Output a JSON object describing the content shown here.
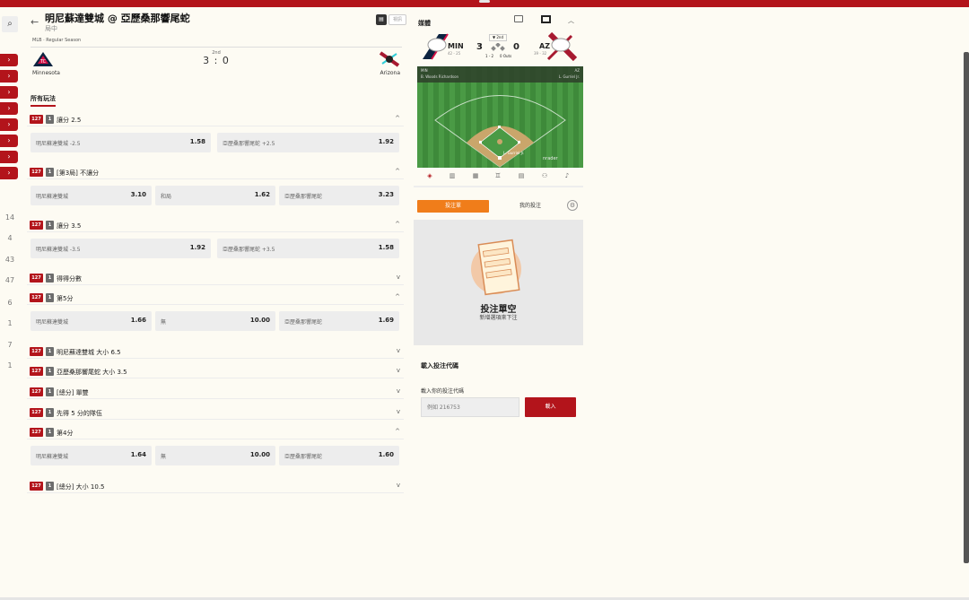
{
  "leftrail": {
    "search_icon": "search-icon",
    "arrow": "›",
    "numbers": [
      "14",
      "4",
      "43",
      "47",
      "6",
      "1",
      "7",
      "1"
    ]
  },
  "game": {
    "back": "←",
    "title": "明尼蘇達雙城 @ 亞歷桑那響尾蛇",
    "status": "局中",
    "viz_label": "視訊",
    "league": "MLB · Regular Season",
    "inning": "2nd",
    "score": "3 : 0",
    "home": "Minnesota",
    "away": "Arizona"
  },
  "all_bets_tab": "所有玩法",
  "markets": [
    {
      "id": "127",
      "n": "1",
      "title": "讓分 2.5",
      "chev": "^",
      "options": [
        [
          "明尼蘇達雙城 -2.5",
          "1.58"
        ],
        [
          "亞歷桑那響尾蛇 +2.5",
          "1.92"
        ]
      ]
    },
    {
      "id": "127",
      "n": "1",
      "title": "[第3局] 不讓分",
      "chev": "^",
      "options": [
        [
          "明尼蘇達雙城",
          "3.10"
        ],
        [
          "和局",
          "1.62"
        ],
        [
          "亞歷桑那響尾蛇",
          "3.23"
        ]
      ]
    },
    {
      "id": "127",
      "n": "1",
      "title": "讓分 3.5",
      "chev": "^",
      "options": [
        [
          "明尼蘇達雙城 -3.5",
          "1.92"
        ],
        [
          "亞歷桑那響尾蛇 +3.5",
          "1.58"
        ]
      ]
    },
    {
      "id": "127",
      "n": "1",
      "title": "得得分數",
      "chev": "v",
      "options": []
    },
    {
      "id": "127",
      "n": "1",
      "title": "第5分",
      "chev": "^",
      "options": [
        [
          "明尼蘇達雙城",
          "1.66"
        ],
        [
          "無",
          "10.00"
        ],
        [
          "亞歷桑那響尾蛇",
          "1.69"
        ]
      ]
    },
    {
      "id": "127",
      "n": "1",
      "title": "明尼蘇達雙城 大小 6.5",
      "chev": "v",
      "options": []
    },
    {
      "id": "127",
      "n": "1",
      "title": "亞歷桑那響尾蛇 大小 3.5",
      "chev": "v",
      "options": []
    },
    {
      "id": "127",
      "n": "1",
      "title": "[總分] 單雙",
      "chev": "v",
      "options": []
    },
    {
      "id": "127",
      "n": "1",
      "title": "先得 5 分的隊伍",
      "chev": "v",
      "options": []
    },
    {
      "id": "127",
      "n": "1",
      "title": "第4分",
      "chev": "^",
      "options": [
        [
          "明尼蘇達雙城",
          "1.64"
        ],
        [
          "無",
          "10.00"
        ],
        [
          "亞歷桑那響尾蛇",
          "1.60"
        ]
      ]
    },
    {
      "id": "127",
      "n": "1",
      "title": "[總分] 大小 10.5",
      "chev": "v",
      "options": []
    }
  ],
  "media": {
    "title": "媒體",
    "home_abbr": "MIN",
    "home_record": "42 - 25",
    "away_abbr": "AZ",
    "away_record": "39 - 32",
    "home_runs": "3",
    "away_runs": "0",
    "inning": "▼ 2nd",
    "count": "1 - 2",
    "outs": "0 Outs",
    "batter": "B. Woods Richardson",
    "pitcher": "L. Gurriel Jr.",
    "field_batter_tag": "L. Gurriel Jr.",
    "field_brand": "nrader"
  },
  "betslip": {
    "tab_betslip": "投注單",
    "tab_mybets": "我的投注",
    "empty_title": "投注單空",
    "empty_sub": "新增選項來下注",
    "load_title": "載入投注代碼",
    "load_label": "載入你的投注代碼",
    "placeholder": "例如 216753",
    "load_button": "載入"
  },
  "colors": {
    "brand_red": "#b3141b",
    "accent_orange": "#f07d1a"
  }
}
